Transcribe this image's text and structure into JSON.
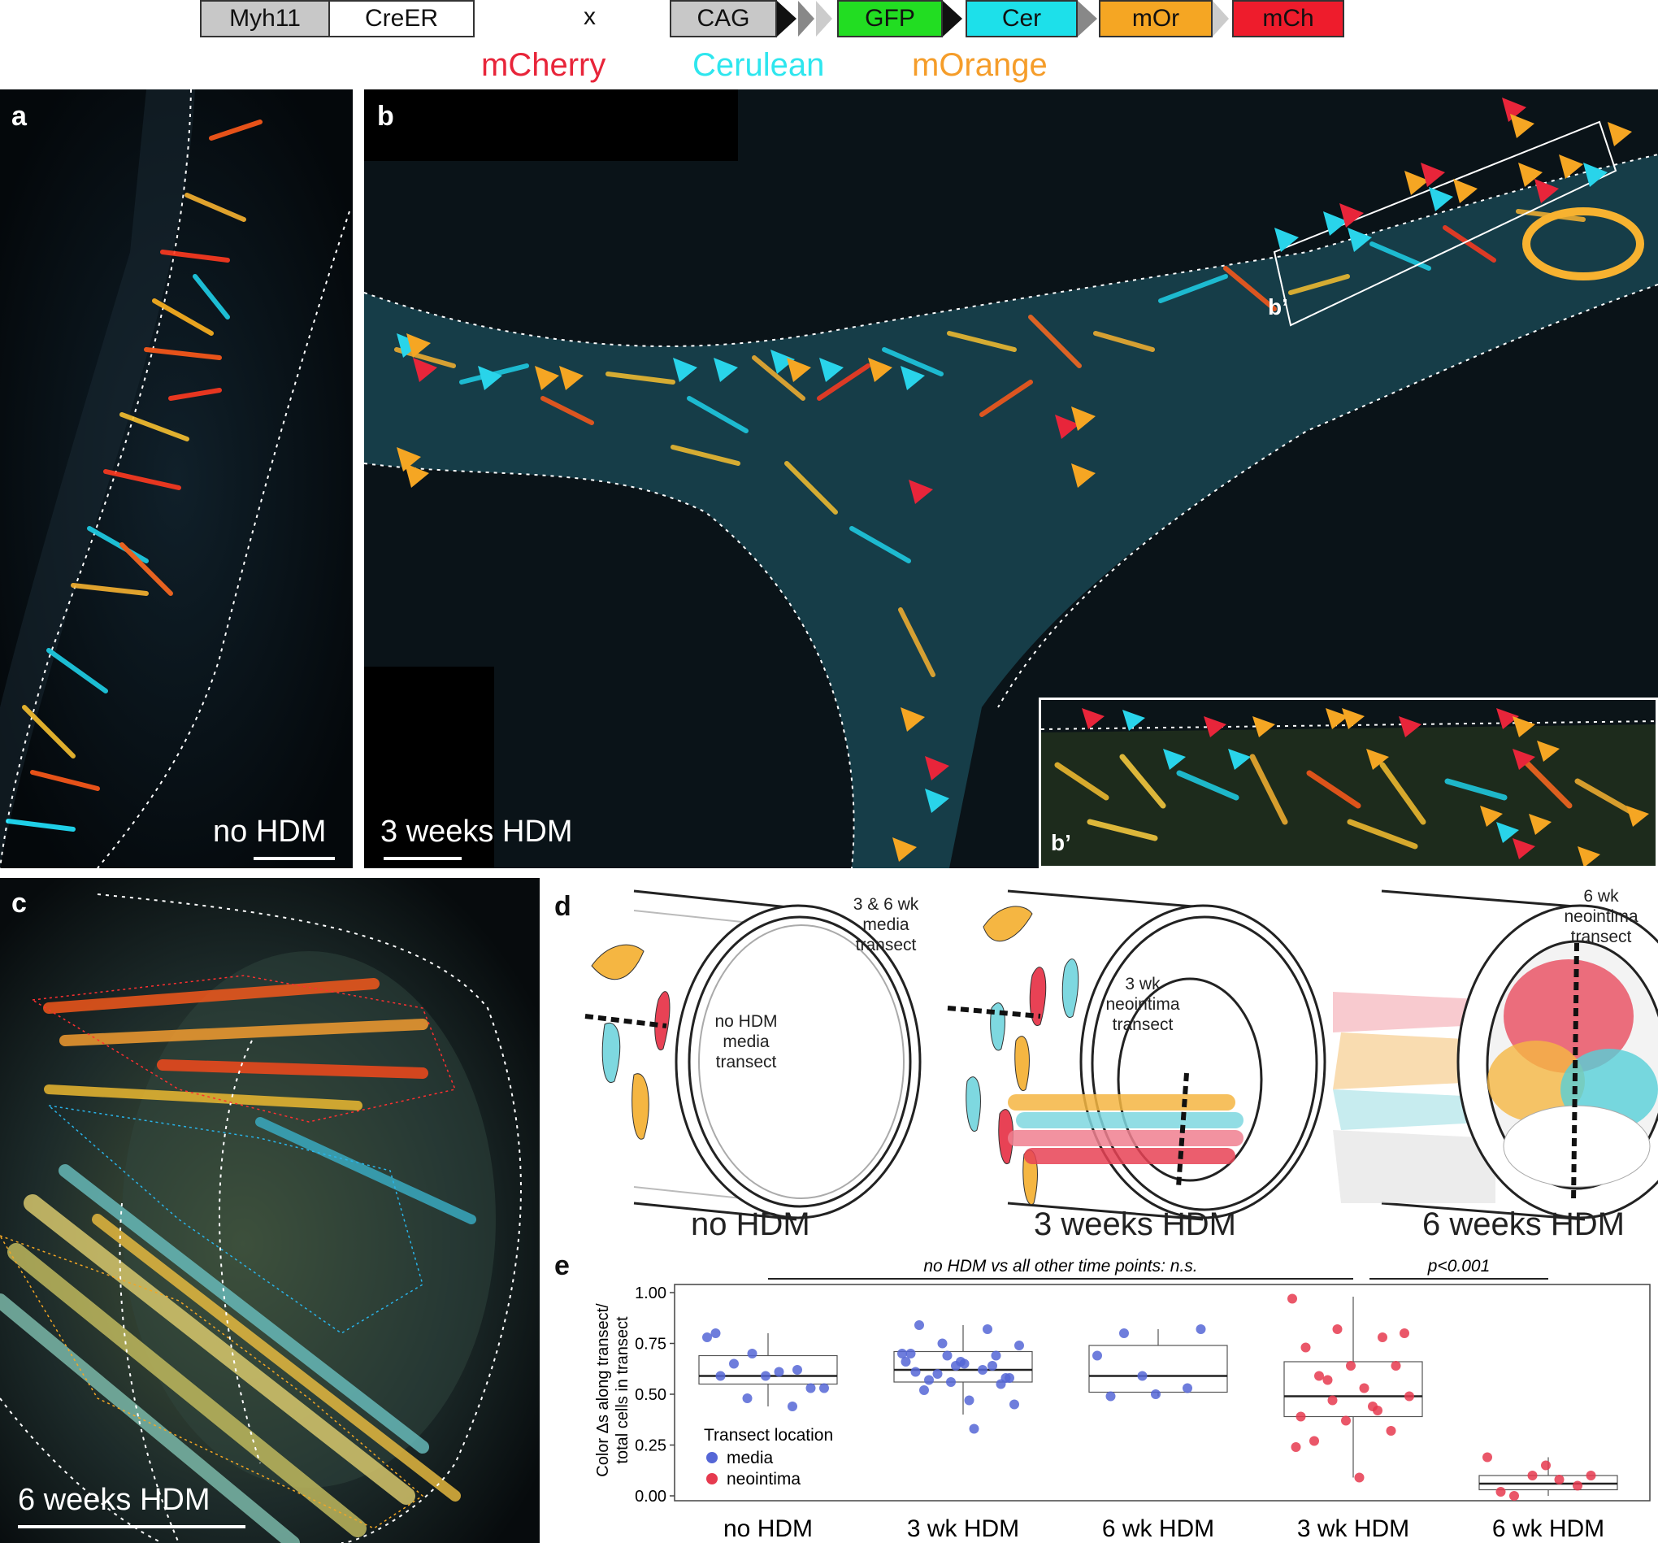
{
  "construct": {
    "left": [
      "Myh11",
      "CreER"
    ],
    "cross": "x",
    "right": [
      "CAG",
      "GFP",
      "Cer",
      "mOr",
      "mCh"
    ],
    "colors": {
      "gray": "#c8c8c8",
      "gfp": "#22dd22",
      "cer": "#1de0ea",
      "mor": "#f5a623",
      "mch": "#ee1c2c"
    }
  },
  "fluor_legend": [
    {
      "label": "mCherry",
      "color": "#e8253a"
    },
    {
      "label": "Cerulean",
      "color": "#2ee6ee"
    },
    {
      "label": "mOrange",
      "color": "#f59d2a"
    }
  ],
  "panels": {
    "a": {
      "letter": "a",
      "caption": "no HDM"
    },
    "b": {
      "letter": "b",
      "caption": "3 weeks HDM",
      "inset_label": "b’",
      "inset_letter": "b’"
    },
    "c": {
      "letter": "c",
      "caption": "6 weeks HDM"
    },
    "d": {
      "letter": "d",
      "captions": [
        "no HDM",
        "3 weeks HDM",
        "6 weeks HDM"
      ],
      "labels": {
        "media_nohdm": [
          "no HDM",
          "media",
          "transect"
        ],
        "media_36": [
          "3 & 6 wk",
          "media",
          "transect"
        ],
        "neo_3": [
          "3 wk",
          "neointima",
          "transect"
        ],
        "neo_6": [
          "6 wk",
          "neointima",
          "transect"
        ]
      }
    },
    "e": {
      "letter": "e"
    }
  },
  "chart_data": {
    "type": "scatter",
    "ylabel": "Color Δs along transect/ total cells in transect",
    "ylim": [
      0,
      1
    ],
    "yticks": [
      "0.00",
      "0.25",
      "0.50",
      "0.75",
      "1.00"
    ],
    "categories": [
      "no HDM",
      "3 wk HDM",
      "6 wk HDM",
      "3 wk HDM",
      "6 wk HDM"
    ],
    "annotations": {
      "ns": "no HDM vs all other time points: n.s.",
      "p": "p<0.001"
    },
    "legend": {
      "title": "Transect location",
      "entries": [
        {
          "name": "media",
          "color": "#5566d6"
        },
        {
          "name": "neointima",
          "color": "#e63a4f"
        }
      ]
    },
    "groups": [
      {
        "location": "media",
        "color": "#5566d6",
        "box": {
          "q1": 0.55,
          "median": 0.59,
          "q3": 0.69,
          "min": 0.44,
          "max": 0.8
        },
        "points": [
          0.78,
          0.7,
          0.62,
          0.59,
          0.59,
          0.53,
          0.65,
          0.61,
          0.53,
          0.48,
          0.44,
          0.8
        ]
      },
      {
        "location": "media",
        "color": "#5566d6",
        "box": {
          "q1": 0.56,
          "median": 0.62,
          "q3": 0.71,
          "min": 0.4,
          "max": 0.84
        },
        "points": [
          0.7,
          0.69,
          0.64,
          0.61,
          0.66,
          0.58,
          0.57,
          0.33,
          0.74,
          0.75,
          0.82,
          0.7,
          0.64,
          0.55,
          0.52,
          0.47,
          0.45,
          0.6,
          0.62,
          0.66,
          0.56,
          0.69,
          0.84,
          0.65,
          0.58
        ]
      },
      {
        "location": "media",
        "color": "#5566d6",
        "box": {
          "q1": 0.51,
          "median": 0.59,
          "q3": 0.74,
          "min": 0.49,
          "max": 0.82
        },
        "points": [
          0.69,
          0.59,
          0.53,
          0.49,
          0.5,
          0.82,
          0.8
        ]
      },
      {
        "location": "neointima",
        "color": "#e63a4f",
        "box": {
          "q1": 0.39,
          "median": 0.49,
          "q3": 0.66,
          "min": 0.09,
          "max": 0.98
        },
        "points": [
          0.97,
          0.82,
          0.78,
          0.73,
          0.64,
          0.64,
          0.59,
          0.53,
          0.49,
          0.47,
          0.42,
          0.39,
          0.37,
          0.32,
          0.27,
          0.09,
          0.8,
          0.57,
          0.44,
          0.24
        ]
      },
      {
        "location": "neointima",
        "color": "#e63a4f",
        "box": {
          "q1": 0.03,
          "median": 0.06,
          "q3": 0.1,
          "min": 0.0,
          "max": 0.19
        },
        "points": [
          0.19,
          0.1,
          0.05,
          0.02,
          0.15,
          0.1,
          0.0,
          0.08
        ]
      }
    ]
  }
}
